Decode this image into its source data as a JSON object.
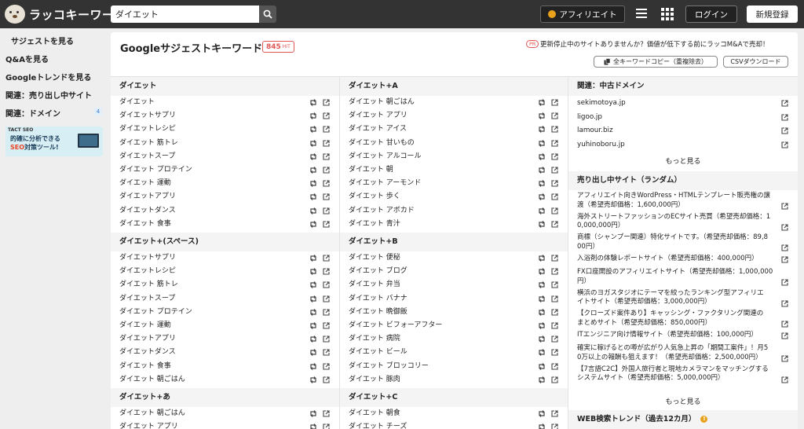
{
  "header": {
    "logo_text": "ラッコキーワード",
    "search_value": "ダイエット",
    "affiliate_label": "アフィリエイト",
    "login_label": "ログイン",
    "signup_label": "新規登録"
  },
  "sidebar": {
    "items": [
      {
        "label": "サジェストを見る"
      },
      {
        "label": "Q&Aを見る"
      },
      {
        "label": "Googleトレンドを見る"
      },
      {
        "label": "関連：売り出し中サイト"
      },
      {
        "label": "関連：ドメイン",
        "badge": "4"
      }
    ],
    "banner": {
      "brand": "TACT SEO",
      "line1": "的確に分析できる",
      "line2_highlight": "SEO",
      "line2_rest": "対策ツール!"
    }
  },
  "main": {
    "title": "Googleサジェストキーワード",
    "hit_count": "845",
    "hit_unit": "HIT",
    "pr_badge": "PR",
    "pr_text": "更新停止中のサイトありませんか？価値が低下する前にラッコM&Aで売却！",
    "copy_button": "全キーワードコピー（重複除去）",
    "csv_button": "CSVダウンロード"
  },
  "col1": {
    "groups": [
      {
        "heading": "ダイエット",
        "items": [
          "ダイエット",
          "ダイエットサプリ",
          "ダイエットレシピ",
          "ダイエット 筋トレ",
          "ダイエットスープ",
          "ダイエット プロテイン",
          "ダイエット 運動",
          "ダイエットアプリ",
          "ダイエットダンス",
          "ダイエット 食事"
        ]
      },
      {
        "heading": "ダイエット+(スペース)",
        "items": [
          "ダイエットサプリ",
          "ダイエットレシピ",
          "ダイエット 筋トレ",
          "ダイエットスープ",
          "ダイエット プロテイン",
          "ダイエット 運動",
          "ダイエットアプリ",
          "ダイエットダンス",
          "ダイエット 食事",
          "ダイエット 朝ごはん"
        ]
      },
      {
        "heading": "ダイエット+あ",
        "items": [
          "ダイエット 朝ごはん",
          "ダイエット アプリ"
        ]
      }
    ]
  },
  "col2": {
    "groups": [
      {
        "heading": "ダイエット+A",
        "items": [
          "ダイエット 朝ごはん",
          "ダイエット アプリ",
          "ダイエット アイス",
          "ダイエット 甘いもの",
          "ダイエット アルコール",
          "ダイエット 朝",
          "ダイエット アーモンド",
          "ダイエット 歩く",
          "ダイエット アボカド",
          "ダイエット 青汁"
        ]
      },
      {
        "heading": "ダイエット+B",
        "items": [
          "ダイエット 便秘",
          "ダイエット ブログ",
          "ダイエット 弁当",
          "ダイエット バナナ",
          "ダイエット 晩御飯",
          "ダイエット ビフォーアフター",
          "ダイエット 病院",
          "ダイエット ビール",
          "ダイエット ブロッコリー",
          "ダイエット 豚肉"
        ]
      },
      {
        "heading": "ダイエット+C",
        "items": [
          "ダイエット 朝食",
          "ダイエット チーズ"
        ]
      }
    ]
  },
  "col3": {
    "domains_heading": "関連：中古ドメイン",
    "domains": [
      "sekimotoya.jp",
      "ligoo.jp",
      "lamour.biz",
      "yuhinoboru.jp"
    ],
    "more1": "もっと見る",
    "sites_heading": "売り出し中サイト（ランダム）",
    "sites": [
      {
        "l1": "アフィリエイト向きWordPress・HTMLテンプレート販売権の譲",
        "l2": "渡（希望売却価格：1,600,000円）"
      },
      {
        "l1": "海外ストリートファッションのECサイト売買（希望売却価格：1",
        "l2": "0,000,000円）"
      },
      {
        "l1": "商標（シャンプー関連）特化サイトです。（希望売却価格：89,8",
        "l2": "00円）"
      },
      {
        "l1": "入浴剤の体験レポートサイト（希望売却価格：400,000円）",
        "l2": ""
      },
      {
        "l1": "FX口座開設のアフィリエイトサイト（希望売却価格：1,000,000",
        "l2": "円）"
      },
      {
        "l1": "横浜のヨガスタジオにテーマを絞ったランキング型アフィリエ",
        "l2": "イトサイト（希望売却価格：3,000,000円）"
      },
      {
        "l1": "【クローズド案件あり】キャッシング・ファクタリング関連の",
        "l2": "まとめサイト（希望売却価格：850,000円）"
      },
      {
        "l1": "ITエンジニア向け情報サイト（希望売却価格：100,000円）",
        "l2": ""
      },
      {
        "l1": "確実に稼げるとの噂が広がり人気急上昇の「期間工案件」！月5",
        "l2": "0万以上の報酬も狙えます！（希望売却価格：2,500,000円）"
      },
      {
        "l1": "【7言語C2C】外国人旅行者と現地カメラマンをマッチングする",
        "l2": "システムサイト（希望売却価格：5,000,000円）"
      }
    ],
    "more2": "もっと見る",
    "trend_heading": "WEB検索トレンド（過去12カ月）",
    "trend_badge": "!"
  }
}
